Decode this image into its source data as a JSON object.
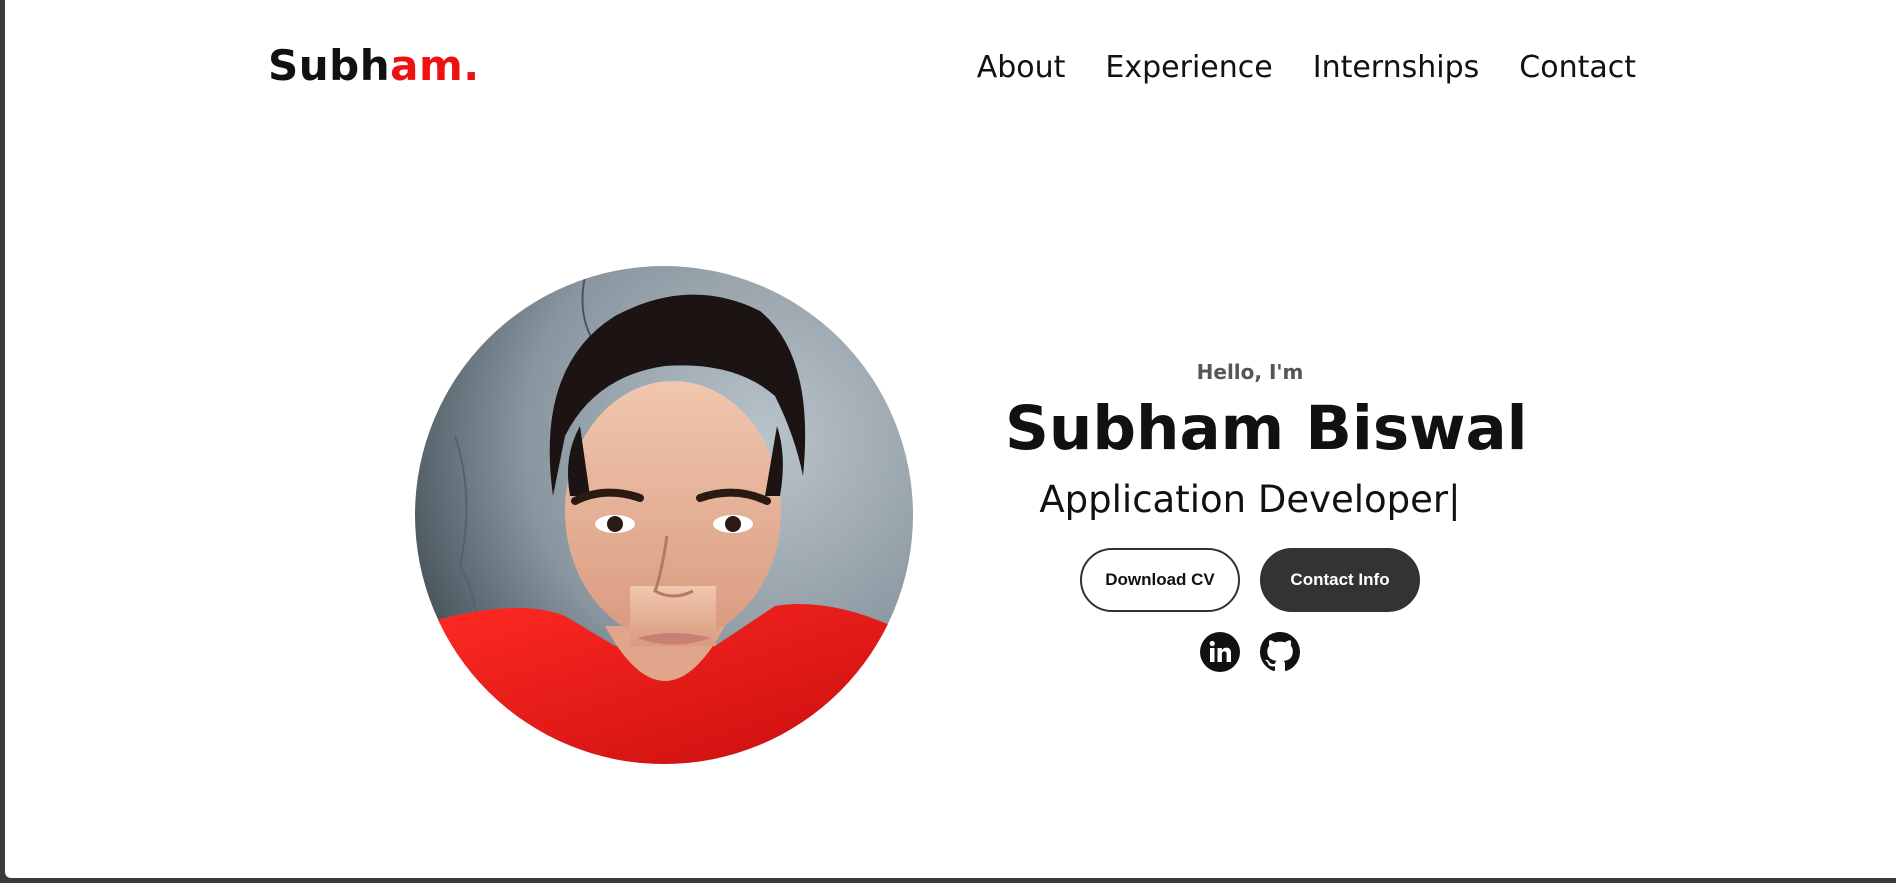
{
  "header": {
    "logo_main": "Subh",
    "logo_accent": "am.",
    "accent_color": "#ee1111",
    "nav": [
      "About",
      "Experience",
      "Internships",
      "Contact"
    ]
  },
  "hero": {
    "greeting": "Hello, I'm",
    "name": "Subham Biswal",
    "role": "Application Developer|",
    "buttons": {
      "download": "Download CV",
      "contact": "Contact Info"
    },
    "socials": [
      {
        "icon": "linkedin-icon"
      },
      {
        "icon": "github-icon"
      }
    ],
    "photo": {
      "icon": "profile-photo"
    }
  }
}
